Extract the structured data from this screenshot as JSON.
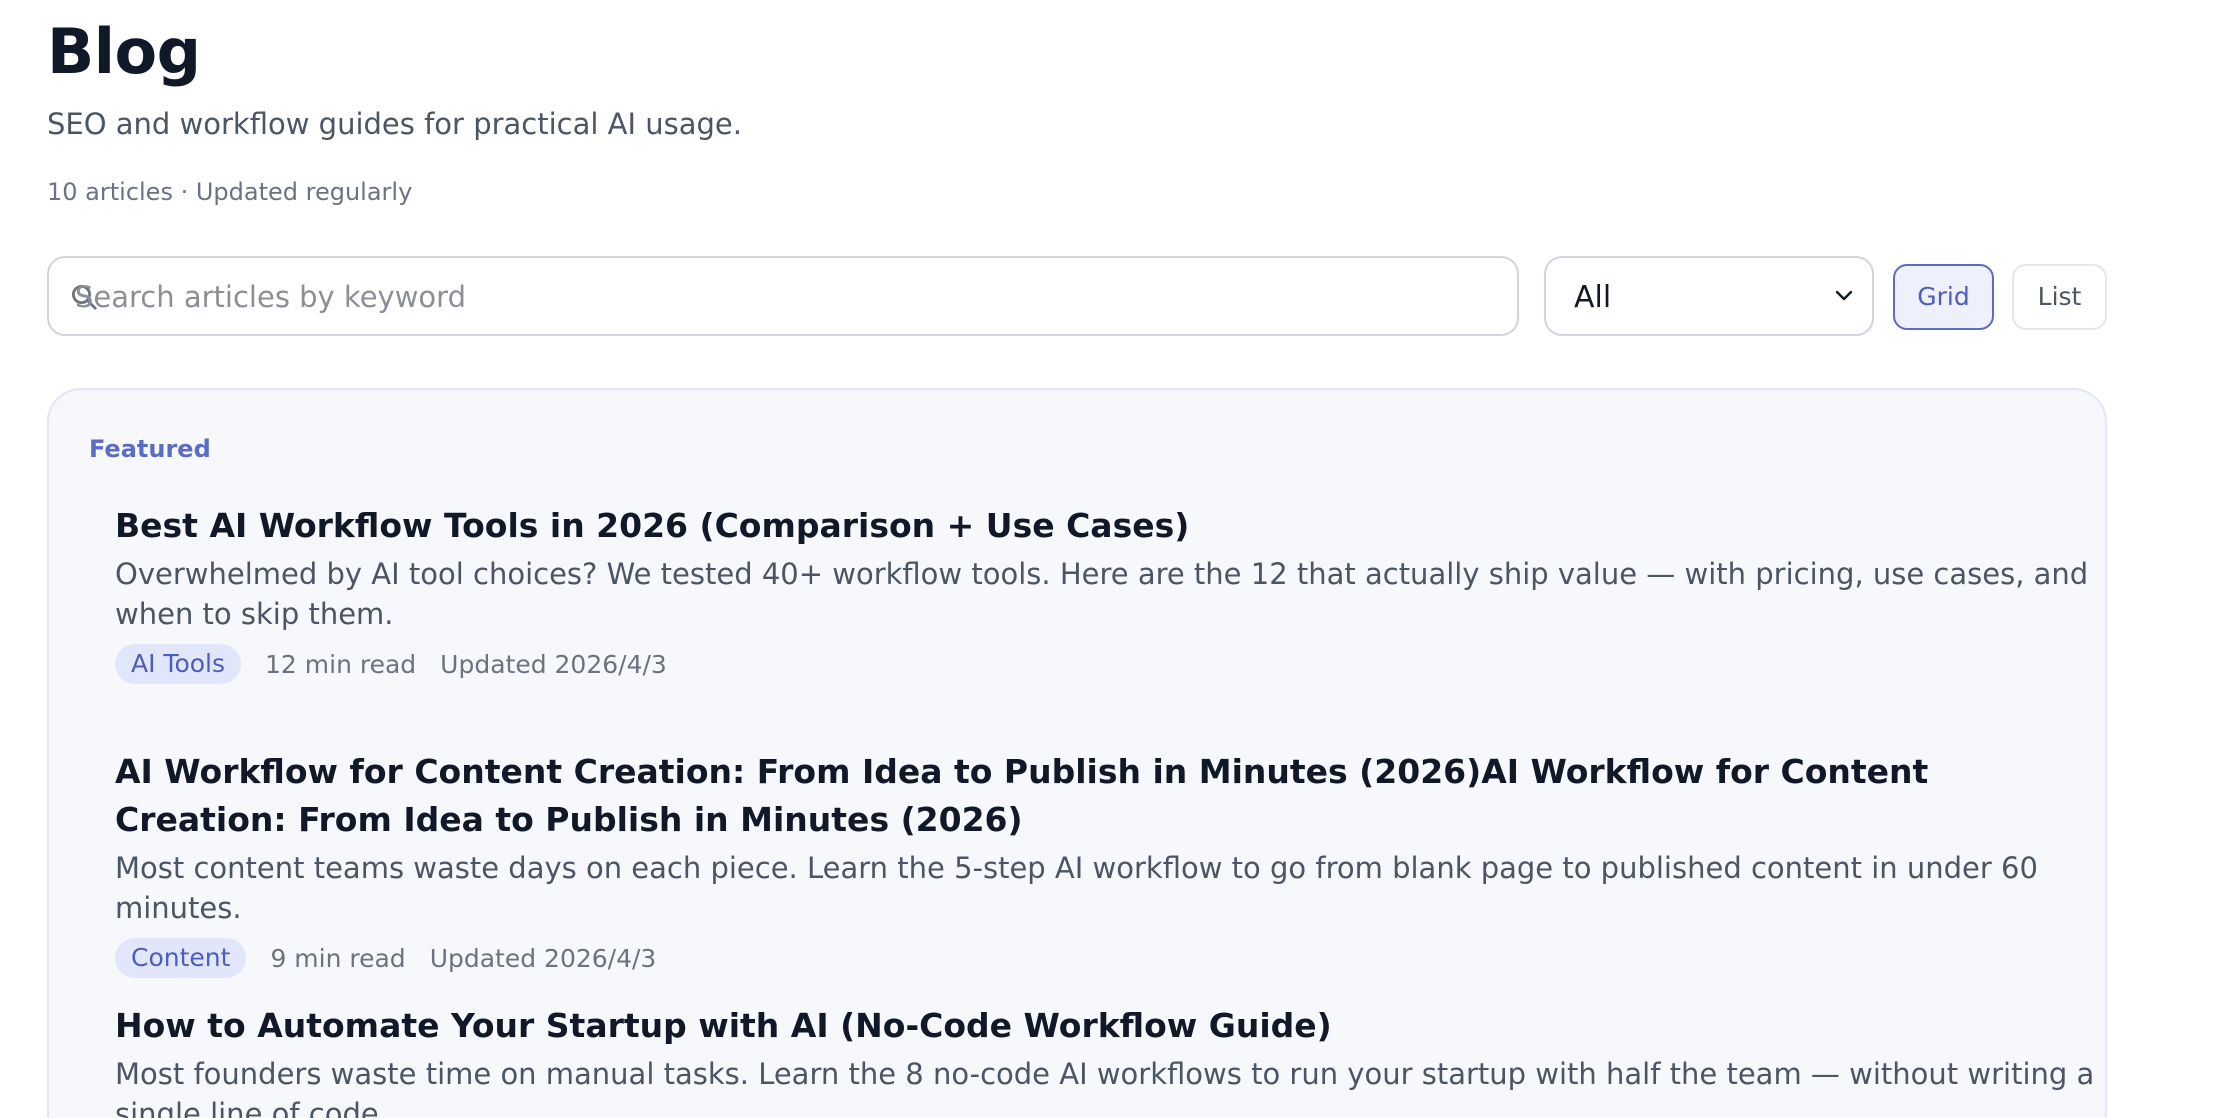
{
  "header": {
    "title": "Blog",
    "subtitle": "SEO and workflow guides for practical AI usage.",
    "meta": "10 articles · Updated regularly"
  },
  "controls": {
    "search_placeholder": "Search articles by keyword",
    "search_icon": "search-icon",
    "category_selected": "All",
    "grid_label": "Grid",
    "list_label": "List",
    "active_view": "Grid"
  },
  "featured": {
    "label": "Featured",
    "articles": [
      {
        "title": "Best AI Workflow Tools in 2026 (Comparison + Use Cases)",
        "description": "Overwhelmed by AI tool choices? We tested 40+ workflow tools. Here are the 12 that actually ship value — with pricing, use cases, and when to skip them.",
        "tag": "AI Tools",
        "read_time": "12 min read",
        "updated": "Updated 2026/4/3"
      },
      {
        "title": "AI Workflow for Content Creation: From Idea to Publish in Minutes (2026)AI Workflow for Content Creation: From Idea to Publish in Minutes (2026)",
        "description": "Most content teams waste days on each piece. Learn the 5-step AI workflow to go from blank page to published content in under 60 minutes.",
        "tag": "Content",
        "read_time": "9 min read",
        "updated": "Updated 2026/4/3"
      },
      {
        "title": "How to Automate Your Startup with AI (No-Code Workflow Guide)",
        "description": "Most founders waste time on manual tasks. Learn the 8 no-code AI workflows to run your startup with half the team — without writing a single line of code."
      }
    ]
  },
  "colors": {
    "accent": "#5b6cc4",
    "tag_bg": "#e2e6fa",
    "card_bg": "#f7f8fc"
  }
}
